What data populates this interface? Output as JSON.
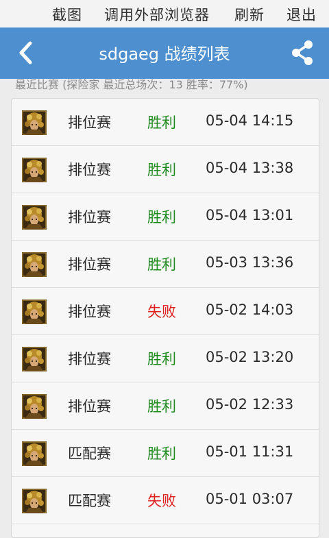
{
  "browser_menu": {
    "screenshot": "截图",
    "open_external": "调用外部浏览器",
    "refresh": "刷新",
    "exit": "退出"
  },
  "header": {
    "back_icon": "chevron-left-icon",
    "title": "sdgaeg 战绩列表",
    "share_icon": "share-icon"
  },
  "summary": "最近比赛 (探险家 最近总场次：13 胜率：77%)",
  "colors": {
    "title_bar": "#4e8fcf",
    "win": "#1e8a1e",
    "loss": "#e02020"
  },
  "matches": [
    {
      "mode": "排位赛",
      "result": "胜利",
      "outcome": "win",
      "time": "05-04 14:15"
    },
    {
      "mode": "排位赛",
      "result": "胜利",
      "outcome": "win",
      "time": "05-04 13:38"
    },
    {
      "mode": "排位赛",
      "result": "胜利",
      "outcome": "win",
      "time": "05-04 13:01"
    },
    {
      "mode": "排位赛",
      "result": "胜利",
      "outcome": "win",
      "time": "05-03 13:36"
    },
    {
      "mode": "排位赛",
      "result": "失败",
      "outcome": "loss",
      "time": "05-02 14:03"
    },
    {
      "mode": "排位赛",
      "result": "胜利",
      "outcome": "win",
      "time": "05-02 13:20"
    },
    {
      "mode": "排位赛",
      "result": "胜利",
      "outcome": "win",
      "time": "05-02 12:33"
    },
    {
      "mode": "匹配赛",
      "result": "胜利",
      "outcome": "win",
      "time": "05-01 11:31"
    },
    {
      "mode": "匹配赛",
      "result": "失败",
      "outcome": "loss",
      "time": "05-01 03:07"
    }
  ]
}
